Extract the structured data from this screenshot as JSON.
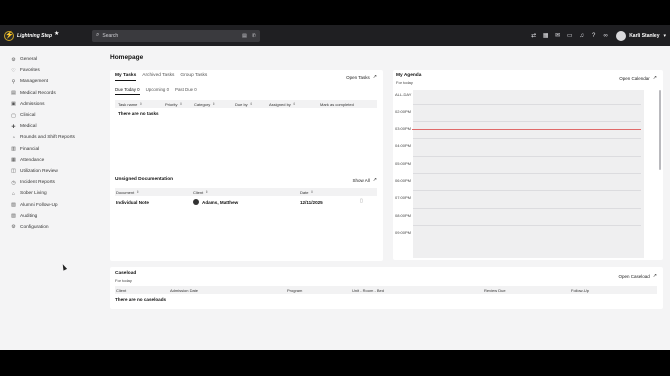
{
  "app": {
    "name": "Lightning Step"
  },
  "search": {
    "placeholder": "Search"
  },
  "user": {
    "name": "Karli Stanley"
  },
  "sidebar": {
    "items": [
      {
        "label": "General",
        "icon": "settings-icon"
      },
      {
        "label": "Favorites",
        "icon": "heart-icon"
      },
      {
        "label": "Management",
        "icon": "pin-icon"
      },
      {
        "label": "Medical Records",
        "icon": "records-icon"
      },
      {
        "label": "Admissions",
        "icon": "admissions-icon"
      },
      {
        "label": "Clinical",
        "icon": "clinical-icon"
      },
      {
        "label": "Medical",
        "icon": "medical-icon"
      },
      {
        "label": "Rounds and Shift Reports",
        "icon": "rounds-icon"
      },
      {
        "label": "Financial",
        "icon": "financial-icon"
      },
      {
        "label": "Attendance",
        "icon": "attendance-icon"
      },
      {
        "label": "Utilization Review",
        "icon": "review-icon"
      },
      {
        "label": "Incident Reports",
        "icon": "incident-icon"
      },
      {
        "label": "Sober Living",
        "icon": "home-icon"
      },
      {
        "label": "Alumni Follow-Up",
        "icon": "alumni-icon"
      },
      {
        "label": "Auditing",
        "icon": "auditing-icon"
      },
      {
        "label": "Configuration",
        "icon": "gear-icon"
      }
    ]
  },
  "page": {
    "title": "Homepage"
  },
  "tasks": {
    "tabs": [
      "My Tasks",
      "Archived Tasks",
      "Group Tasks"
    ],
    "open_label": "Open Tasks",
    "subtabs": [
      "Due Today 0",
      "Upcoming 0",
      "Past Due 0"
    ],
    "columns": [
      "Task name",
      "Priority",
      "Category",
      "Due by",
      "Assigned by",
      "Mark as completed"
    ],
    "empty": "There are no tasks"
  },
  "unsigned": {
    "title": "Unsigned Documentation",
    "show_all": "Show All",
    "columns": [
      "Document",
      "Client",
      "Date"
    ],
    "rows": [
      {
        "document": "Individual Note",
        "client": "Adams, Matthew",
        "date": "12/11/2025"
      }
    ]
  },
  "agenda": {
    "title": "My Agenda",
    "subtitle": "For today",
    "open_label": "Open Calendar",
    "all_day": "ALL-DAY",
    "times": [
      "02:00PM",
      "03:00PM",
      "04:00PM",
      "05:00PM",
      "06:00PM",
      "07:00PM",
      "08:00PM",
      "09:00PM"
    ]
  },
  "caseload": {
    "title": "Caseload",
    "subtitle": "For today",
    "open_label": "Open Caseload",
    "columns": [
      "Client",
      "Admission Date",
      "Program",
      "Unit - Room - Bed",
      "Review Due",
      "Follow-Up"
    ],
    "empty": "There are no caseloads"
  },
  "colors": {
    "topbar": "#1f1f22",
    "accent": "#f2c230",
    "now_line": "#e06a6a"
  }
}
